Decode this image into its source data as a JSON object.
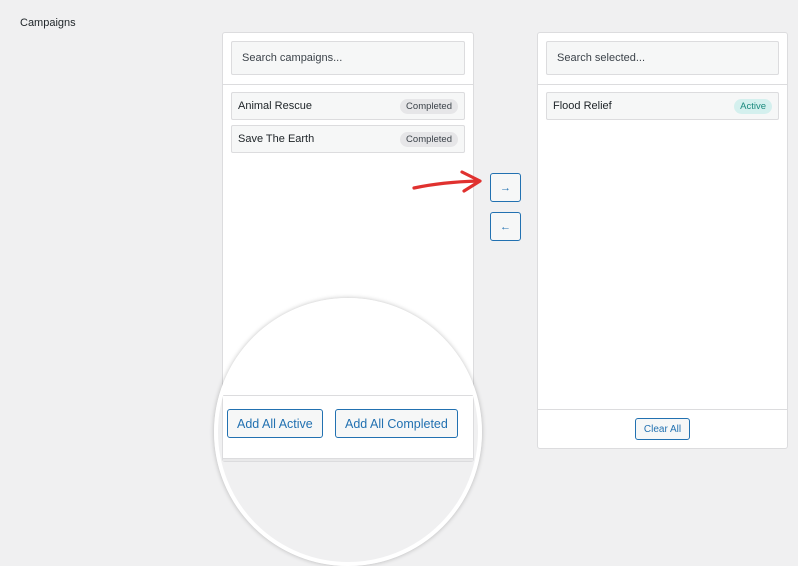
{
  "section_label": "Campaigns",
  "available": {
    "search_placeholder": "Search campaigns...",
    "items": [
      {
        "name": "Animal Rescue",
        "status": "Completed"
      },
      {
        "name": "Save The Earth",
        "status": "Completed"
      }
    ],
    "add_active_label": "Add All Active",
    "add_completed_label": "Add All Completed"
  },
  "selected": {
    "search_placeholder": "Search selected...",
    "items": [
      {
        "name": "Flood Relief",
        "status": "Active"
      }
    ],
    "clear_label": "Clear All"
  },
  "transfer": {
    "move_right_glyph": "→",
    "move_left_glyph": "←"
  },
  "colors": {
    "accent": "#2271b1",
    "annotation_arrow": "#e0312f",
    "active_badge": "#1b8a7e"
  }
}
